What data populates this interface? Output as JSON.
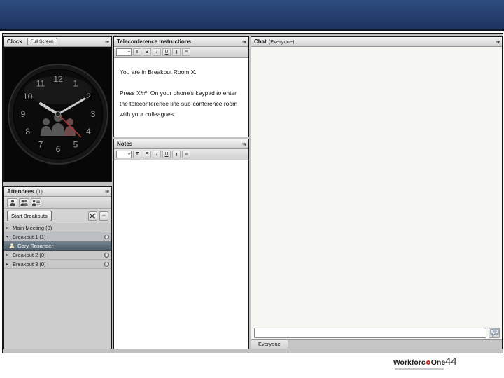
{
  "icons": {
    "pod_menu": "≡▾",
    "chevron_down": "▾",
    "chevron_right": "▸",
    "plus": "+"
  },
  "clock_pod": {
    "title": "Clock",
    "full_screen_label": "Full Screen",
    "numbers": [
      "12",
      "1",
      "2",
      "3",
      "4",
      "5",
      "6",
      "7",
      "8",
      "9",
      "10",
      "11"
    ]
  },
  "teleconference_pod": {
    "title": "Teleconference Instructions",
    "paragraph1": "You are in Breakout Room X.",
    "paragraph2": "Press X##: On your phone's keypad to enter the teleconference line sub-conference room with your colleagues."
  },
  "notes_pod": {
    "title": "Notes"
  },
  "chat_pod": {
    "title": "Chat",
    "scope": "(Everyone)",
    "tab_label": "Everyone",
    "input_value": ""
  },
  "attendees_pod": {
    "title": "Attendees",
    "count": "(1)",
    "start_breakouts_label": "Start Breakouts",
    "rows": [
      {
        "label": "Main Meeting (0)",
        "type": "room",
        "expanded": false,
        "gear": false,
        "shade": false,
        "selected": false
      },
      {
        "label": "Breakout 1 (1)",
        "type": "room",
        "expanded": true,
        "gear": true,
        "shade": true,
        "selected": false
      },
      {
        "label": "Gary Rosander",
        "type": "attendee",
        "expanded": false,
        "gear": false,
        "shade": false,
        "selected": true
      },
      {
        "label": "Breakout 2 (0)",
        "type": "room",
        "expanded": false,
        "gear": true,
        "shade": false,
        "selected": false
      },
      {
        "label": "Breakout 3 (0)",
        "type": "room",
        "expanded": false,
        "gear": true,
        "shade": false,
        "selected": false
      }
    ]
  },
  "text_toolbar": {
    "buttons": [
      {
        "name": "text-color-button",
        "glyph": "T",
        "cls": "tcolor"
      },
      {
        "name": "bold-button",
        "glyph": "B",
        "cls": "bold"
      },
      {
        "name": "italic-button",
        "glyph": "I",
        "cls": "italic"
      },
      {
        "name": "underline-button",
        "glyph": "U",
        "cls": "underline"
      },
      {
        "name": "highlight-button",
        "glyph": "▮",
        "cls": "block"
      },
      {
        "name": "bullet-list-button",
        "glyph": "≡",
        "cls": "list"
      }
    ]
  },
  "footer": {
    "page_number": "44",
    "logo_pre": "Workforc",
    "logo_post": "One"
  }
}
